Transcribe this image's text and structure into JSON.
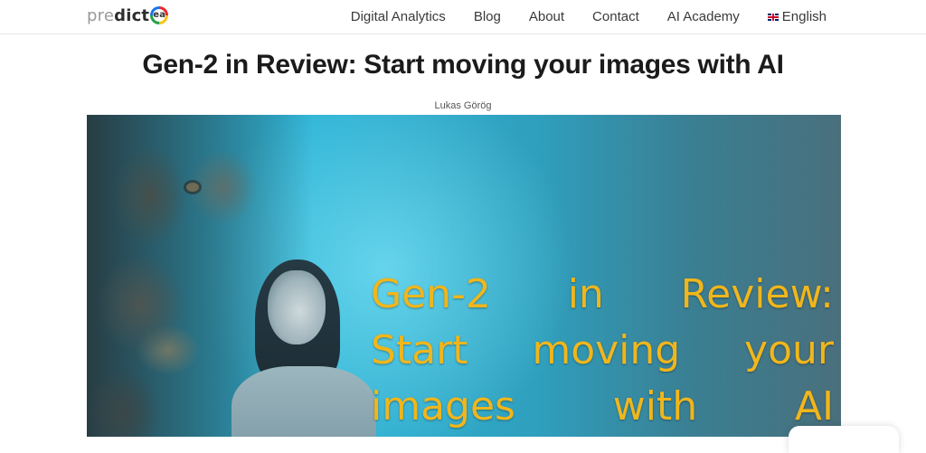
{
  "header": {
    "logo": {
      "prefix": "pre",
      "main": "dict",
      "mark": "ea"
    },
    "nav": [
      {
        "label": "Digital Analytics"
      },
      {
        "label": "Blog"
      },
      {
        "label": "About"
      },
      {
        "label": "Contact"
      },
      {
        "label": "AI Academy"
      },
      {
        "label": "English",
        "icon": "uk-flag-icon"
      }
    ]
  },
  "article": {
    "title": "Gen-2 in Review: Start moving your images with AI",
    "author": "Lukas Görög",
    "hero": {
      "text_lines": [
        "Gen-2 in Review:",
        "Start moving your",
        "images with AI"
      ],
      "text_color": "#f0b61c",
      "background_color": "#2fb4d6"
    }
  }
}
